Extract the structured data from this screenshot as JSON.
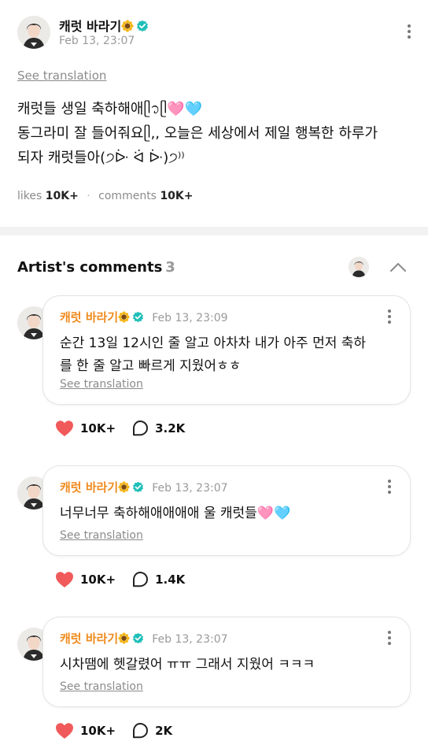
{
  "post": {
    "author": "캐럿 바라기",
    "author_badge": "sunflower-emoji",
    "time": "Feb 13, 23:07",
    "see_translation": "See translation",
    "body_lines": [
      "캐럿들 생일 축하해애ᥫ᭡ᥫ🩷🩵",
      "동그라미 잘 들어줘요ᥫ,, 오늘은 세상에서 제일 행복한 하루가",
      "되자 캐럿들아(੭ᐕ ᐛ ᐕ)੭⁾⁾"
    ],
    "likes_label": "likes",
    "likes_value": "10K+",
    "comments_label": "comments",
    "comments_value": "10K+"
  },
  "artist_comments": {
    "title": "Artist's comments",
    "count": "3"
  },
  "comments": [
    {
      "author": "캐럿 바라기",
      "time": "Feb 13, 23:09",
      "text_lines": [
        "순간 13일 12시인 줄 알고 아차차 내가 아주 먼저 축하",
        "를 한 줄 알고 빠르게 지웠어ㅎㅎ"
      ],
      "see_translation": "See translation",
      "likes": "10K+",
      "replies": "3.2K"
    },
    {
      "author": "캐럿 바라기",
      "time": "Feb 13, 23:07",
      "text_lines": [
        "너무너무 축하해애애애애 울 캐럿들🩷🩵"
      ],
      "see_translation": "See translation",
      "likes": "10K+",
      "replies": "1.4K"
    },
    {
      "author": "캐럿 바라기",
      "time": "Feb 13, 23:07",
      "text_lines": [
        "시차땜에 헷갈렸어 ㅠㅠ 그래서 지웠어 ㅋㅋㅋ"
      ],
      "see_translation": "See translation",
      "likes": "10K+",
      "replies": "2K"
    }
  ],
  "colors": {
    "accent_name": "#f08a1c",
    "verified": "#1fbfb8",
    "heart": "#f15a5a",
    "muted": "#9a9a9a"
  }
}
